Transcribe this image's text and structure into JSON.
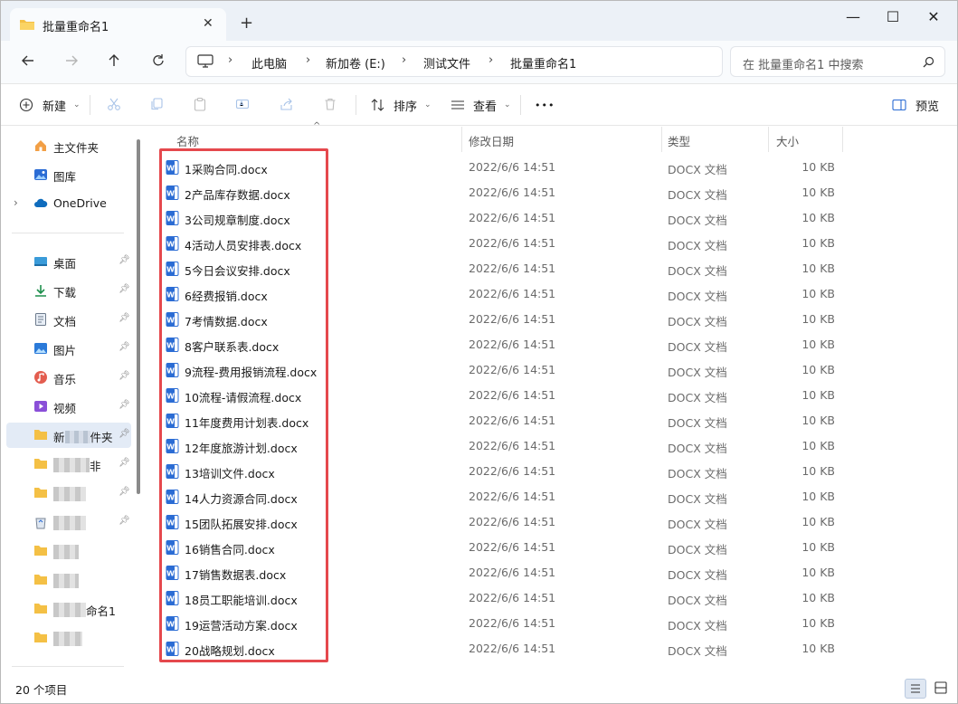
{
  "window": {
    "tab_title": "批量重命名1",
    "controls": {
      "minimize": "—",
      "maximize": "☐",
      "close": "✕"
    }
  },
  "address": {
    "crumbs": [
      "此电脑",
      "新加卷 (E:)",
      "测试文件",
      "批量重命名1"
    ],
    "search_placeholder": "在 批量重命名1 中搜索"
  },
  "toolbar": {
    "new_label": "新建",
    "sort_label": "排序",
    "view_label": "查看",
    "more_label": "•••",
    "preview_label": "预览"
  },
  "sidebar": {
    "home": "主文件夹",
    "gallery": "图库",
    "onedrive": "OneDrive",
    "desktop": "桌面",
    "downloads": "下载",
    "documents": "文档",
    "pictures": "图片",
    "music": "音乐",
    "videos": "视频",
    "folder_new_prefix": "新",
    "folder_new_suffix": "件夹",
    "folder2_suffix": "非",
    "folder_batch_suffix": "命名1"
  },
  "columns": {
    "name": "名称",
    "date": "修改日期",
    "type": "类型",
    "size": "大小"
  },
  "files": [
    {
      "name": "1采购合同.docx",
      "date": "2022/6/6 14:51",
      "type": "DOCX 文档",
      "size": "10 KB"
    },
    {
      "name": "2产品库存数据.docx",
      "date": "2022/6/6 14:51",
      "type": "DOCX 文档",
      "size": "10 KB"
    },
    {
      "name": "3公司规章制度.docx",
      "date": "2022/6/6 14:51",
      "type": "DOCX 文档",
      "size": "10 KB"
    },
    {
      "name": "4活动人员安排表.docx",
      "date": "2022/6/6 14:51",
      "type": "DOCX 文档",
      "size": "10 KB"
    },
    {
      "name": "5今日会议安排.docx",
      "date": "2022/6/6 14:51",
      "type": "DOCX 文档",
      "size": "10 KB"
    },
    {
      "name": "6经费报销.docx",
      "date": "2022/6/6 14:51",
      "type": "DOCX 文档",
      "size": "10 KB"
    },
    {
      "name": "7考情数据.docx",
      "date": "2022/6/6 14:51",
      "type": "DOCX 文档",
      "size": "10 KB"
    },
    {
      "name": "8客户联系表.docx",
      "date": "2022/6/6 14:51",
      "type": "DOCX 文档",
      "size": "10 KB"
    },
    {
      "name": "9流程-费用报销流程.docx",
      "date": "2022/6/6 14:51",
      "type": "DOCX 文档",
      "size": "10 KB"
    },
    {
      "name": "10流程-请假流程.docx",
      "date": "2022/6/6 14:51",
      "type": "DOCX 文档",
      "size": "10 KB"
    },
    {
      "name": "11年度费用计划表.docx",
      "date": "2022/6/6 14:51",
      "type": "DOCX 文档",
      "size": "10 KB"
    },
    {
      "name": "12年度旅游计划.docx",
      "date": "2022/6/6 14:51",
      "type": "DOCX 文档",
      "size": "10 KB"
    },
    {
      "name": "13培训文件.docx",
      "date": "2022/6/6 14:51",
      "type": "DOCX 文档",
      "size": "10 KB"
    },
    {
      "name": "14人力资源合同.docx",
      "date": "2022/6/6 14:51",
      "type": "DOCX 文档",
      "size": "10 KB"
    },
    {
      "name": "15团队拓展安排.docx",
      "date": "2022/6/6 14:51",
      "type": "DOCX 文档",
      "size": "10 KB"
    },
    {
      "name": "16销售合同.docx",
      "date": "2022/6/6 14:51",
      "type": "DOCX 文档",
      "size": "10 KB"
    },
    {
      "name": "17销售数据表.docx",
      "date": "2022/6/6 14:51",
      "type": "DOCX 文档",
      "size": "10 KB"
    },
    {
      "name": "18员工职能培训.docx",
      "date": "2022/6/6 14:51",
      "type": "DOCX 文档",
      "size": "10 KB"
    },
    {
      "name": "19运营活动方案.docx",
      "date": "2022/6/6 14:51",
      "type": "DOCX 文档",
      "size": "10 KB"
    },
    {
      "name": "20战略规划.docx",
      "date": "2022/6/6 14:51",
      "type": "DOCX 文档",
      "size": "10 KB"
    }
  ],
  "status": {
    "item_count": "20 个项目"
  },
  "colors": {
    "highlight": "#e5484d",
    "word_blue": "#2b6cd4",
    "folder_yellow": "#f4c045"
  }
}
